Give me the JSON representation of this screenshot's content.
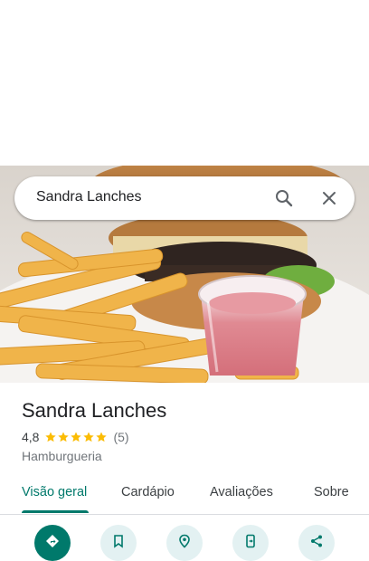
{
  "search": {
    "query": "Sandra Lanches"
  },
  "place": {
    "name": "Sandra Lanches",
    "rating": "4,8",
    "reviews": "(5)",
    "category": "Hamburgueria"
  },
  "tabs": [
    {
      "label": "Visão geral",
      "active": true
    },
    {
      "label": "Cardápio"
    },
    {
      "label": "Avaliações"
    },
    {
      "label": "Sobre"
    }
  ],
  "actions": [
    {
      "icon": "directions-icon"
    },
    {
      "icon": "bookmark-icon"
    },
    {
      "icon": "nearby-icon"
    },
    {
      "icon": "send-to-phone-icon"
    },
    {
      "icon": "share-icon"
    }
  ],
  "colors": {
    "accent": "#00796b",
    "star": "#fbbc04",
    "action_bg": "#e3f1f2"
  }
}
